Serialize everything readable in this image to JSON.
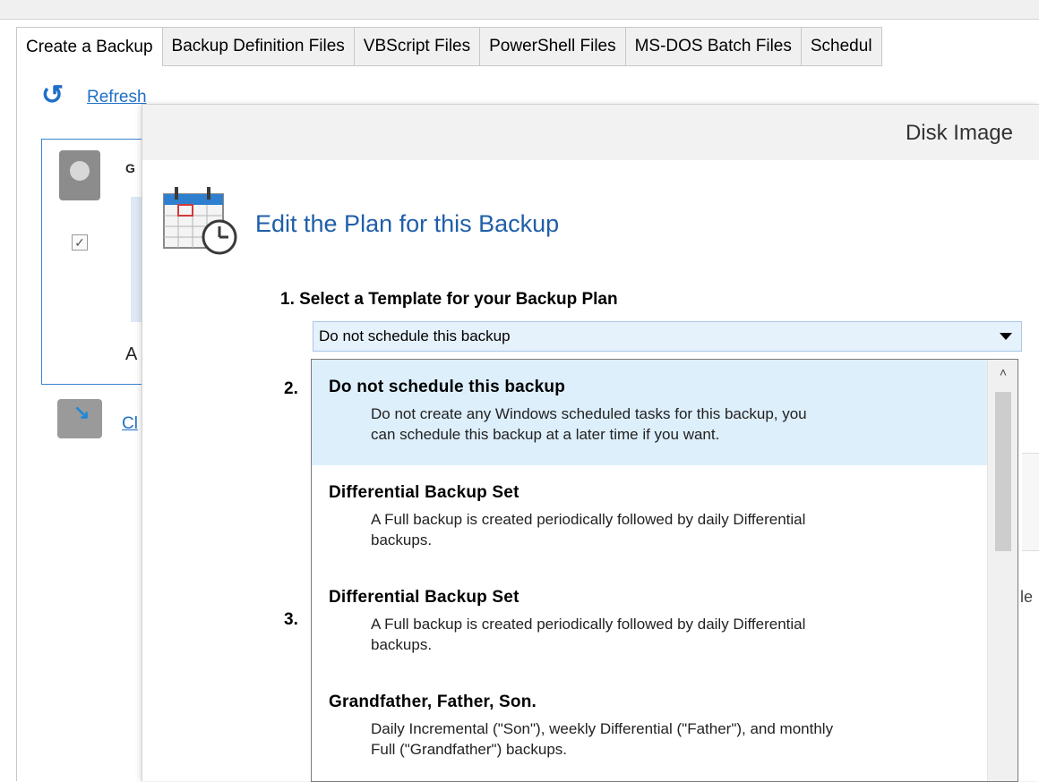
{
  "tabs": [
    {
      "label": "Create a Backup",
      "active": true
    },
    {
      "label": "Backup Definition Files",
      "active": false
    },
    {
      "label": "VBScript Files",
      "active": false
    },
    {
      "label": "PowerShell Files",
      "active": false
    },
    {
      "label": "MS-DOS Batch Files",
      "active": false
    },
    {
      "label": "Schedul",
      "active": false
    }
  ],
  "background": {
    "refresh_label": "Refresh",
    "panel_letter_g": "G",
    "panel_letter_a": "A",
    "clone_link_partial": "Cl"
  },
  "dialog": {
    "title": "Disk Image",
    "heading": "Edit the Plan for this Backup",
    "step1_label": "1. Select a Template for your Backup Plan",
    "step2_label": "2.",
    "step3_label": "3.",
    "right_fragment": "le",
    "template_combo": {
      "selected_value": "Do not schedule this backup",
      "options": [
        {
          "title": "Do not schedule this backup",
          "description_line1": "Do not create any Windows scheduled tasks for this backup, you",
          "description_line2": "can schedule this backup at a later time if you want.",
          "selected": true
        },
        {
          "title": "Differential Backup Set",
          "description_line1": "A Full backup is created periodically followed by daily Differential",
          "description_line2": "backups.",
          "selected": false
        },
        {
          "title": "Differential Backup Set",
          "description_line1": "A Full backup is created periodically followed by daily Differential",
          "description_line2": "backups.",
          "selected": false
        },
        {
          "title": "Grandfather, Father, Son.",
          "description_line1": "Daily Incremental (\"Son\"), weekly Differential (\"Father\"), and monthly",
          "description_line2": "Full (\"Grandfather\") backups.",
          "selected": false
        }
      ]
    }
  },
  "colors": {
    "accent_blue": "#1f5fa8",
    "link_blue": "#1f6fc8",
    "selected_row": "#ddeffb",
    "combo_bg": "#e5f1fb"
  }
}
